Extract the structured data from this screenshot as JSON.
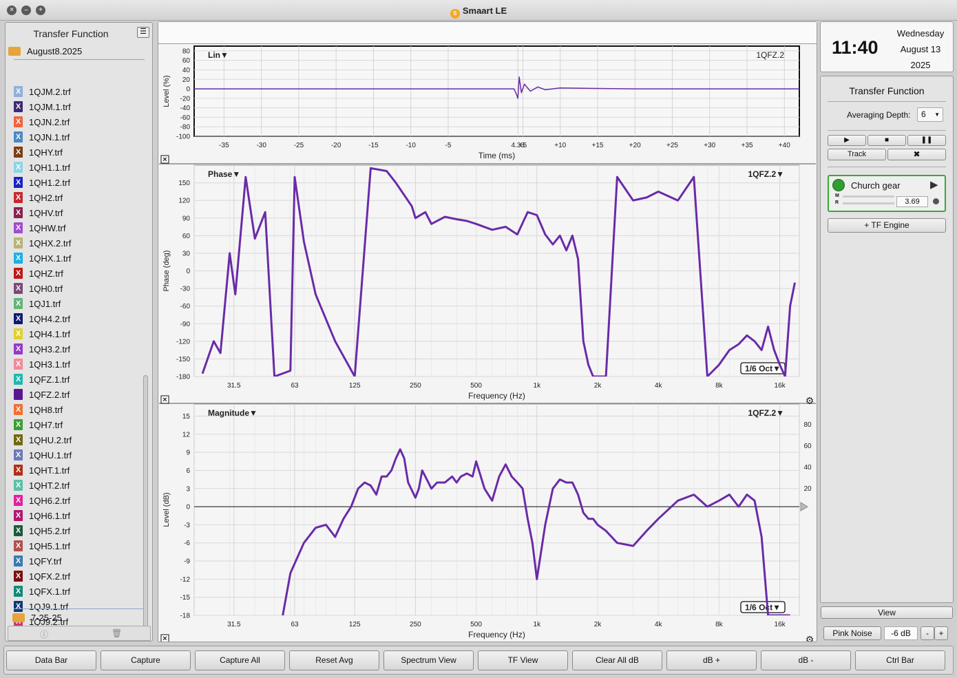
{
  "window": {
    "title": "Smaart LE"
  },
  "sidebar": {
    "title": "Transfer Function",
    "folder_open": "August8.2025",
    "folder_closed": "7-25-25",
    "files": [
      {
        "name": "1QJM.2.trf",
        "color": "#8fb0d8"
      },
      {
        "name": "1QJM.1.trf",
        "color": "#3c2a78"
      },
      {
        "name": "1QJN.2.trf",
        "color": "#f0643c"
      },
      {
        "name": "1QJN.1.trf",
        "color": "#4a88c8"
      },
      {
        "name": "1QHY.trf",
        "color": "#7a3e14"
      },
      {
        "name": "1QH1.1.trf",
        "color": "#8cd4e4"
      },
      {
        "name": "1QH1.2.trf",
        "color": "#1a22c8"
      },
      {
        "name": "1QH2.trf",
        "color": "#c82830"
      },
      {
        "name": "1QHV.trf",
        "color": "#8a2050"
      },
      {
        "name": "1QHW.trf",
        "color": "#a04cd0"
      },
      {
        "name": "1QHX.2.trf",
        "color": "#b8b478"
      },
      {
        "name": "1QHX.1.trf",
        "color": "#18b0e8"
      },
      {
        "name": "1QHZ.trf",
        "color": "#c01818"
      },
      {
        "name": "1QH0.trf",
        "color": "#7a4a78"
      },
      {
        "name": "1QJ1.trf",
        "color": "#64b478"
      },
      {
        "name": "1QH4.2.trf",
        "color": "#101a70"
      },
      {
        "name": "1QH4.1.trf",
        "color": "#e0d030"
      },
      {
        "name": "1QH3.2.trf",
        "color": "#9838c8"
      },
      {
        "name": "1QH3.1.trf",
        "color": "#f08a9a"
      },
      {
        "name": "1QFZ.1.trf",
        "color": "#20b8b0"
      },
      {
        "name": "1QFZ.2.trf",
        "color": "#5a1890"
      },
      {
        "name": "1QH8.trf",
        "color": "#f07030"
      },
      {
        "name": "1QH7.trf",
        "color": "#38a030"
      },
      {
        "name": "1QHU.2.trf",
        "color": "#706a10"
      },
      {
        "name": "1QHU.1.trf",
        "color": "#6a7ab8"
      },
      {
        "name": "1QHT.1.trf",
        "color": "#b03018"
      },
      {
        "name": "1QHT.2.trf",
        "color": "#5ac0a8"
      },
      {
        "name": "1QH6.2.trf",
        "color": "#e020a0"
      },
      {
        "name": "1QH6.1.trf",
        "color": "#b01870"
      },
      {
        "name": "1QH5.2.trf",
        "color": "#1a5a3a"
      },
      {
        "name": "1QH5.1.trf",
        "color": "#b05050"
      },
      {
        "name": "1QFY.trf",
        "color": "#3a7ab0"
      },
      {
        "name": "1QFX.2.trf",
        "color": "#7a1010"
      },
      {
        "name": "1QFX.1.trf",
        "color": "#108a78"
      },
      {
        "name": "1QJ9.1.trf",
        "color": "#103878"
      },
      {
        "name": "1QJ9.2.trf",
        "color": "#c83878"
      }
    ]
  },
  "plots": {
    "impulse": {
      "label": "Lin",
      "trace": "1QFZ.2",
      "ylabel": "Level (%)",
      "xlabel": "Time (ms)",
      "yticks": [
        "80",
        "60",
        "40",
        "20",
        "0",
        "-20",
        "-40",
        "-60",
        "-80",
        "-100"
      ],
      "xticks": [
        "-35",
        "-30",
        "-25",
        "-20",
        "-15",
        "-10",
        "-5",
        "4.33",
        "+5",
        "+10",
        "+15",
        "+20",
        "+25",
        "+30",
        "+35",
        "+40"
      ]
    },
    "phase": {
      "label": "Phase",
      "trace": "1QFZ.2",
      "ylabel": "Phase (deg)",
      "xlabel": "Frequency (Hz)",
      "smoothing": "1/6 Oct",
      "yticks": [
        "150",
        "120",
        "90",
        "60",
        "30",
        "0",
        "-30",
        "-60",
        "-90",
        "-120",
        "-150",
        "-180"
      ],
      "xticks": [
        "31.5",
        "63",
        "125",
        "250",
        "500",
        "1k",
        "2k",
        "4k",
        "8k",
        "16k"
      ]
    },
    "magnitude": {
      "label": "Magnitude",
      "trace": "1QFZ.2",
      "ylabel": "Level (dB)",
      "xlabel": "Frequency (Hz)",
      "smoothing": "1/6 Oct",
      "yticks": [
        "15",
        "12",
        "9",
        "6",
        "3",
        "0",
        "-3",
        "-6",
        "-9",
        "-12",
        "-15",
        "-18"
      ],
      "yticks_right": [
        "80",
        "60",
        "40",
        "20"
      ],
      "xticks": [
        "31.5",
        "63",
        "125",
        "250",
        "500",
        "1k",
        "2k",
        "4k",
        "8k",
        "16k"
      ]
    },
    "trace_color": "#6a2aa8"
  },
  "chart_data": [
    {
      "type": "line",
      "title": "Lin",
      "xlabel": "Time (ms)",
      "ylabel": "Level (%)",
      "xlim": [
        -39,
        42
      ],
      "ylim": [
        -100,
        90
      ],
      "series": [
        {
          "name": "1QFZ.2",
          "x": [
            -39,
            -10,
            0,
            3.8,
            4.1,
            4.33,
            4.5,
            4.8,
            5.2,
            6,
            7,
            8,
            10,
            14,
            20,
            30,
            42
          ],
          "y": [
            0,
            0,
            0,
            0,
            -10,
            -20,
            25,
            -8,
            10,
            -5,
            4,
            -2,
            2,
            1,
            0,
            0,
            0
          ]
        }
      ]
    },
    {
      "type": "line",
      "title": "Phase",
      "xlabel": "Frequency (Hz)",
      "ylabel": "Phase (deg)",
      "xscale": "log",
      "xlim": [
        20,
        20000
      ],
      "ylim": [
        -180,
        180
      ],
      "series": [
        {
          "name": "1QFZ.2",
          "x": [
            22,
            25,
            27,
            30,
            32,
            36,
            40,
            45,
            50,
            60,
            63,
            70,
            80,
            100,
            125,
            150,
            180,
            200,
            240,
            250,
            280,
            300,
            350,
            400,
            450,
            500,
            600,
            700,
            800,
            900,
            1000,
            1100,
            1200,
            1300,
            1400,
            1500,
            1600,
            1700,
            1800,
            1900,
            2000,
            2200,
            2500,
            3000,
            3500,
            4000,
            5000,
            6000,
            7000,
            8000,
            9000,
            10000,
            11000,
            12000,
            13000,
            14000,
            15000,
            16000,
            17000,
            18000,
            19000
          ],
          "y": [
            -175,
            -120,
            -140,
            30,
            -40,
            160,
            55,
            100,
            -180,
            -170,
            160,
            50,
            -40,
            -120,
            -180,
            175,
            170,
            150,
            110,
            90,
            100,
            80,
            92,
            88,
            85,
            80,
            70,
            75,
            62,
            100,
            95,
            62,
            45,
            60,
            35,
            60,
            20,
            -120,
            -160,
            -180,
            -180,
            -180,
            160,
            120,
            125,
            135,
            120,
            160,
            -180,
            -160,
            -135,
            -125,
            -110,
            -120,
            -135,
            -95,
            -135,
            -160,
            -180,
            -60,
            -20
          ]
        }
      ]
    },
    {
      "type": "line",
      "title": "Magnitude",
      "xlabel": "Frequency (Hz)",
      "ylabel": "Level (dB)",
      "xscale": "log",
      "xlim": [
        20,
        20000
      ],
      "ylim": [
        -18,
        17
      ],
      "series": [
        {
          "name": "1QFZ.2",
          "x": [
            55,
            60,
            70,
            80,
            90,
            100,
            110,
            120,
            130,
            140,
            150,
            160,
            170,
            180,
            190,
            200,
            210,
            220,
            230,
            250,
            260,
            270,
            280,
            300,
            320,
            350,
            380,
            400,
            420,
            450,
            480,
            500,
            550,
            600,
            650,
            700,
            750,
            800,
            850,
            900,
            950,
            1000,
            1100,
            1200,
            1300,
            1400,
            1500,
            1600,
            1700,
            1800,
            1900,
            2000,
            2200,
            2500,
            3000,
            3500,
            4000,
            5000,
            6000,
            7000,
            8000,
            9000,
            10000,
            11000,
            12000,
            13000,
            14000,
            15000,
            16000,
            17000,
            18000
          ],
          "y": [
            -18,
            -11,
            -6,
            -3.5,
            -3,
            -5,
            -2,
            0,
            3,
            4,
            3.5,
            2,
            5,
            5,
            6,
            8,
            9.5,
            8,
            4,
            1.5,
            3,
            6,
            5,
            3,
            4,
            4,
            5,
            4,
            5,
            5.5,
            5,
            7.5,
            3,
            1,
            5,
            7,
            5,
            4,
            3,
            -2,
            -6,
            -12,
            -3,
            3,
            4.5,
            4,
            4,
            2,
            -1,
            -2,
            -2,
            -3,
            -4,
            -6,
            -6.5,
            -4,
            -2,
            1,
            2,
            0,
            1,
            2,
            0,
            2,
            1,
            -5,
            -18,
            -18,
            -18,
            -18,
            -18
          ]
        }
      ]
    }
  ],
  "right_panel": {
    "time": "11:40",
    "weekday": "Wednesday",
    "date": "August 13",
    "year": "2025",
    "section_title": "Transfer Function",
    "averaging_label": "Averaging Depth:",
    "averaging_value": "6",
    "track_label": "Track",
    "engine_name": "Church gear",
    "engine_m": "M",
    "engine_r": "R",
    "engine_value": "3.69",
    "add_engine": "+ TF Engine",
    "view_label": "View",
    "pink_noise": "Pink Noise",
    "noise_level": "-6 dB",
    "minus": "-",
    "plus": "+"
  },
  "bottom_bar": [
    "Data Bar",
    "Capture",
    "Capture All",
    "Reset Avg",
    "Spectrum View",
    "TF View",
    "Clear All dB",
    "dB +",
    "dB -",
    "Ctrl Bar"
  ]
}
